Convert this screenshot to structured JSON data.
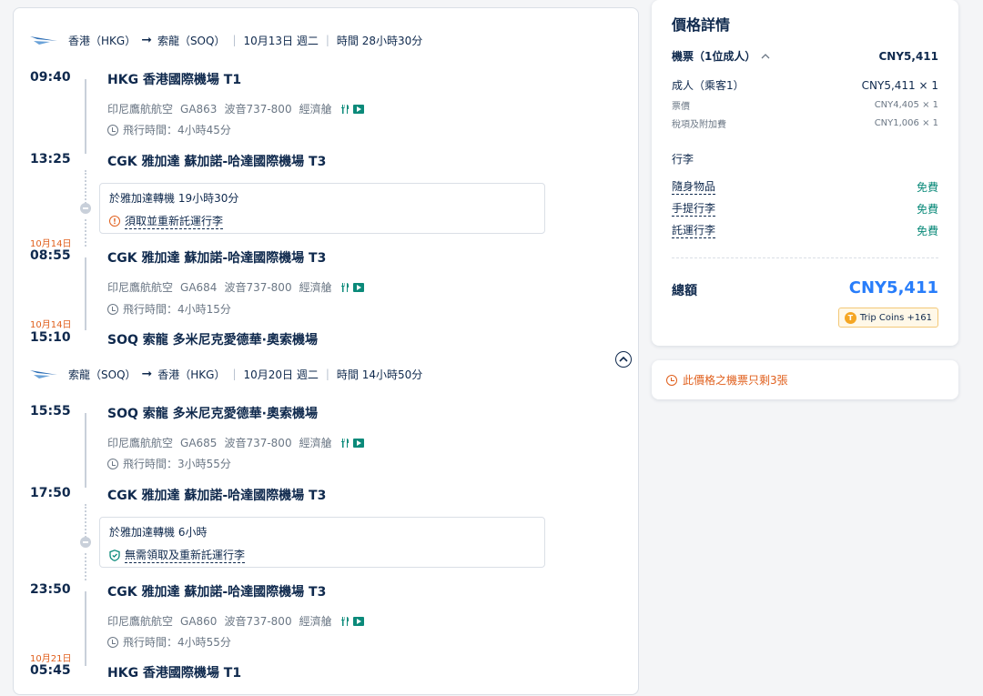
{
  "legs": [
    {
      "from": "香港（HKG）",
      "to": "索龍（SOQ）",
      "date": "10月13日 週二",
      "duration": "時間 28小時30分",
      "segments": [
        {
          "dep_time": "09:40",
          "dep_station": "HKG 香港國際機場 T1",
          "airline": "印尼鷹航航空",
          "flight_no": "GA863",
          "aircraft": "波音737-800",
          "cabin": "經濟艙",
          "flight_time": "飛行時間：4小時45分",
          "arr_time": "13:25",
          "arr_station": "CGK 雅加達 蘇加諾-哈達國際機場 T3"
        },
        {
          "dep_date": "10月14日",
          "dep_time": "08:55",
          "dep_station": "CGK 雅加達 蘇加諾-哈達國際機場 T3",
          "airline": "印尼鷹航航空",
          "flight_no": "GA684",
          "aircraft": "波音737-800",
          "cabin": "經濟艙",
          "flight_time": "飛行時間：4小時15分",
          "arr_date": "10月14日",
          "arr_time": "15:10",
          "arr_station": "SOQ 索龍 多米尼克愛德華·奧索機場"
        }
      ],
      "transfer": {
        "text": "於雅加達轉機  19小時30分",
        "note": "須取並重新託運行李"
      }
    },
    {
      "from": "索龍（SOQ）",
      "to": "香港（HKG）",
      "date": "10月20日 週二",
      "duration": "時間 14小時50分",
      "segments": [
        {
          "dep_time": "15:55",
          "dep_station": "SOQ 索龍 多米尼克愛德華·奧索機場",
          "airline": "印尼鷹航航空",
          "flight_no": "GA685",
          "aircraft": "波音737-800",
          "cabin": "經濟艙",
          "flight_time": "飛行時間：3小時55分",
          "arr_time": "17:50",
          "arr_station": "CGK 雅加達 蘇加諾-哈達國際機場 T3"
        },
        {
          "dep_time": "23:50",
          "dep_station": "CGK 雅加達 蘇加諾-哈達國際機場 T3",
          "airline": "印尼鷹航航空",
          "flight_no": "GA860",
          "aircraft": "波音737-800",
          "cabin": "經濟艙",
          "flight_time": "飛行時間：4小時55分",
          "arr_date": "10月21日",
          "arr_time": "05:45",
          "arr_station": "HKG 香港國際機場 T1"
        }
      ],
      "transfer": {
        "text": "於雅加達轉機  6小時",
        "note": "無需領取及重新託運行李"
      }
    }
  ],
  "price": {
    "title": "價格詳情",
    "ticket_label": "機票（1位成人）",
    "ticket_total": "CNY5,411",
    "adult_label": "成人（乘客1）",
    "adult_value": "CNY5,411 × 1",
    "fare_label": "票價",
    "fare_value": "CNY4,405 × 1",
    "tax_label": "稅項及附加費",
    "tax_value": "CNY1,006 × 1",
    "baggage_title": "行李",
    "baggage": [
      {
        "label": "隨身物品",
        "value": "免費"
      },
      {
        "label": "手提行李",
        "value": "免費"
      },
      {
        "label": "託運行李",
        "value": "免費"
      }
    ],
    "total_label": "總額",
    "total_value": "CNY5,411",
    "coins": "Trip Coins +161"
  },
  "alert": "此價格之機票只剩3張",
  "colors": {
    "accent": "#287dfa",
    "text": "#0f294d",
    "warn": "#e05f1c",
    "free": "#0b8a7a"
  }
}
